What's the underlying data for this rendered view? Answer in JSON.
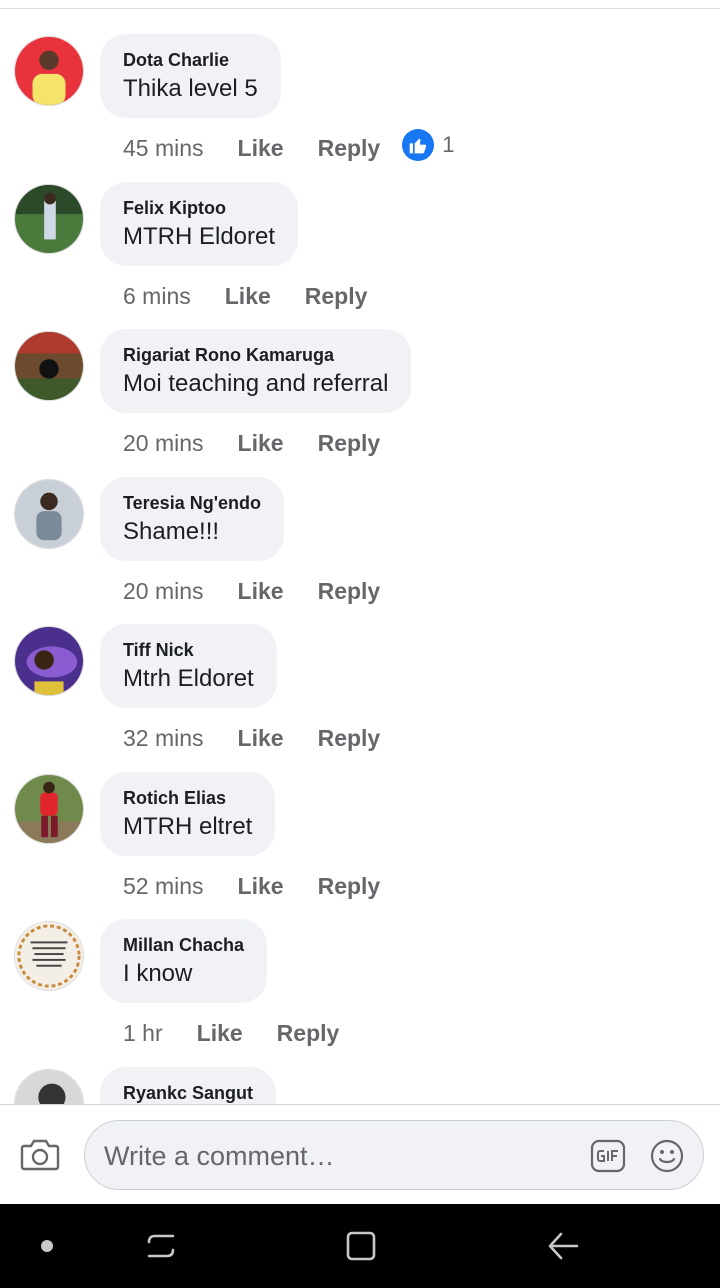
{
  "comments": [
    {
      "author": "Dota Charlie",
      "text": "Thika level 5",
      "time": "45 mins",
      "like_label": "Like",
      "reply_label": "Reply",
      "reaction_count": "1",
      "avatar_color": "#e8323c"
    },
    {
      "author": "Felix Kiptoo",
      "text": "MTRH Eldoret",
      "time": "6 mins",
      "like_label": "Like",
      "reply_label": "Reply",
      "avatar_color": "#4a7a3c"
    },
    {
      "author": "Rigariat Rono Kamaruga",
      "text": "Moi teaching and referral",
      "time": "20 mins",
      "like_label": "Like",
      "reply_label": "Reply",
      "avatar_color": "#6b4a2e"
    },
    {
      "author": "Teresia Ng'endo",
      "text": "Shame!!!",
      "time": "20 mins",
      "like_label": "Like",
      "reply_label": "Reply",
      "avatar_color": "#9aa4ae"
    },
    {
      "author": "Tiff Nick",
      "text": "Mtrh Eldoret",
      "time": "32 mins",
      "like_label": "Like",
      "reply_label": "Reply",
      "avatar_color": "#4b2f8c"
    },
    {
      "author": "Rotich Elias",
      "text": "MTRH eltret",
      "time": "52 mins",
      "like_label": "Like",
      "reply_label": "Reply",
      "avatar_color": "#5d7a3a"
    },
    {
      "author": "Millan Chacha",
      "text": "I know",
      "time": "1 hr",
      "like_label": "Like",
      "reply_label": "Reply",
      "avatar_color": "#f3efe6"
    },
    {
      "author": "Ryankc Sangut",
      "text": "",
      "time": "",
      "like_label": "",
      "reply_label": "",
      "avatar_color": "#555555"
    }
  ],
  "composer": {
    "placeholder": "Write a comment…"
  },
  "icons": {
    "camera": "camera-icon",
    "gif": "gif-icon",
    "emoji": "emoji-icon",
    "like_reaction": "thumbs-up-icon"
  },
  "colors": {
    "accent": "#1877f2",
    "bubble": "#f0f2f5",
    "meta_text": "#65676b",
    "nav_bar": "#000000"
  }
}
